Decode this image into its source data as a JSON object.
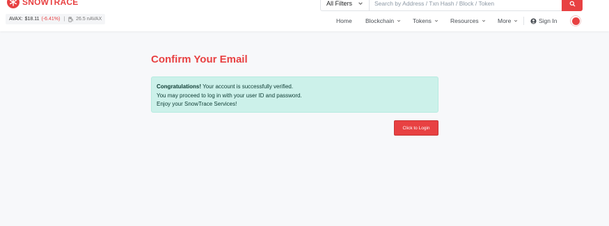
{
  "brand": {
    "name": "SNOWTRACE",
    "color": "#e84142"
  },
  "price_bar": {
    "label": "AVAX:",
    "price": "$18.11",
    "change": "(-6.41%)",
    "separator": "|",
    "gas": "26.5 nAVAX"
  },
  "search": {
    "filter_label": "All Filters",
    "placeholder": "Search by Address / Txn Hash / Block / Token",
    "button_icon": "search-icon"
  },
  "nav": {
    "items": [
      {
        "label": "Home"
      },
      {
        "label": "Blockchain"
      },
      {
        "label": "Tokens"
      },
      {
        "label": "Resources"
      },
      {
        "label": "More"
      }
    ],
    "sign_in": "Sign In"
  },
  "main": {
    "title_prefix": "Confirm Your",
    "title_emphasis": "Email",
    "alert": {
      "strong": "Congratulations!",
      "line1_rest": "Your account is successfully verified.",
      "line2": "You may proceed to log in with your user ID and password.",
      "line3": "Enjoy your SnowTrace Services!"
    },
    "login_button": "Click to Login"
  },
  "colors": {
    "accent": "#e84142",
    "alert_bg": "#ccf1ea",
    "page_bg": "#f7f8fa"
  }
}
